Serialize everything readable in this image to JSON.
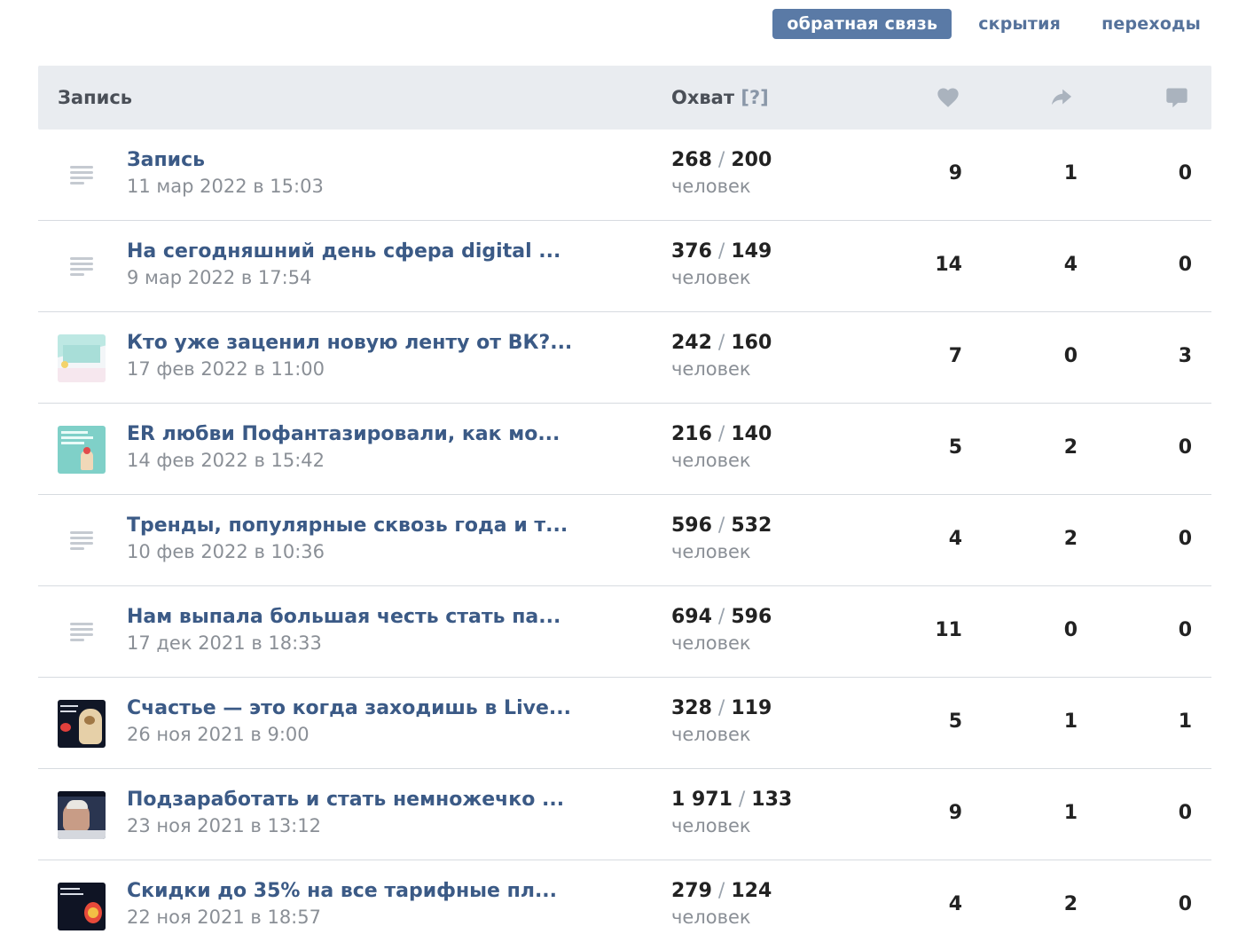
{
  "tabs": [
    {
      "label": "обратная связь",
      "active": true
    },
    {
      "label": "скрытия",
      "active": false
    },
    {
      "label": "переходы",
      "active": false
    }
  ],
  "table": {
    "header": {
      "post": "Запись",
      "reach": "Охват",
      "reach_help": "[?]",
      "icons": [
        "heart-icon",
        "share-icon",
        "comment-icon"
      ]
    },
    "rows": [
      {
        "thumb": "text",
        "title": "Запись",
        "date": "11 мар 2022 в 15:03",
        "reach_total": "268",
        "reach_sub": "200",
        "people": "человек",
        "likes": "9",
        "shares": "1",
        "comments": "0"
      },
      {
        "thumb": "text",
        "title": "На сегодняшний день сфера digital ...",
        "date": "9 мар 2022 в 17:54",
        "reach_total": "376",
        "reach_sub": "149",
        "people": "человек",
        "likes": "14",
        "shares": "4",
        "comments": "0"
      },
      {
        "thumb": "image",
        "title": "Кто уже заценил новую ленту от ВК?...",
        "date": "17 фев 2022 в 11:00",
        "reach_total": "242",
        "reach_sub": "160",
        "people": "человек",
        "likes": "7",
        "shares": "0",
        "comments": "3"
      },
      {
        "thumb": "image",
        "title": "ER любви Пофантазировали, как мо...",
        "date": "14 фев 2022 в 15:42",
        "reach_total": "216",
        "reach_sub": "140",
        "people": "человек",
        "likes": "5",
        "shares": "2",
        "comments": "0"
      },
      {
        "thumb": "text",
        "title": "Тренды, популярные сквозь года и т...",
        "date": "10 фев 2022 в 10:36",
        "reach_total": "596",
        "reach_sub": "532",
        "people": "человек",
        "likes": "4",
        "shares": "2",
        "comments": "0"
      },
      {
        "thumb": "text",
        "title": "Нам выпала большая честь стать па...",
        "date": "17 дек 2021 в 18:33",
        "reach_total": "694",
        "reach_sub": "596",
        "people": "человек",
        "likes": "11",
        "shares": "0",
        "comments": "0"
      },
      {
        "thumb": "image",
        "title": "Счастье — это когда заходишь в Live...",
        "date": "26 ноя 2021 в 9:00",
        "reach_total": "328",
        "reach_sub": "119",
        "people": "человек",
        "likes": "5",
        "shares": "1",
        "comments": "1"
      },
      {
        "thumb": "image",
        "title": "Подзаработать и стать немножечко ...",
        "date": "23 ноя 2021 в 13:12",
        "reach_total": "1 971",
        "reach_sub": "133",
        "people": "человек",
        "likes": "9",
        "shares": "1",
        "comments": "0"
      },
      {
        "thumb": "image",
        "title": "Скидки до 35% на все тарифные пл...",
        "date": "22 ноя 2021 в 18:57",
        "reach_total": "279",
        "reach_sub": "124",
        "people": "человек",
        "likes": "4",
        "shares": "2",
        "comments": "0"
      }
    ]
  },
  "colors": {
    "accent": "#5a7aa6",
    "link": "#3b5a86",
    "header_bg": "#e9ecf0",
    "muted": "#8a8f96"
  }
}
